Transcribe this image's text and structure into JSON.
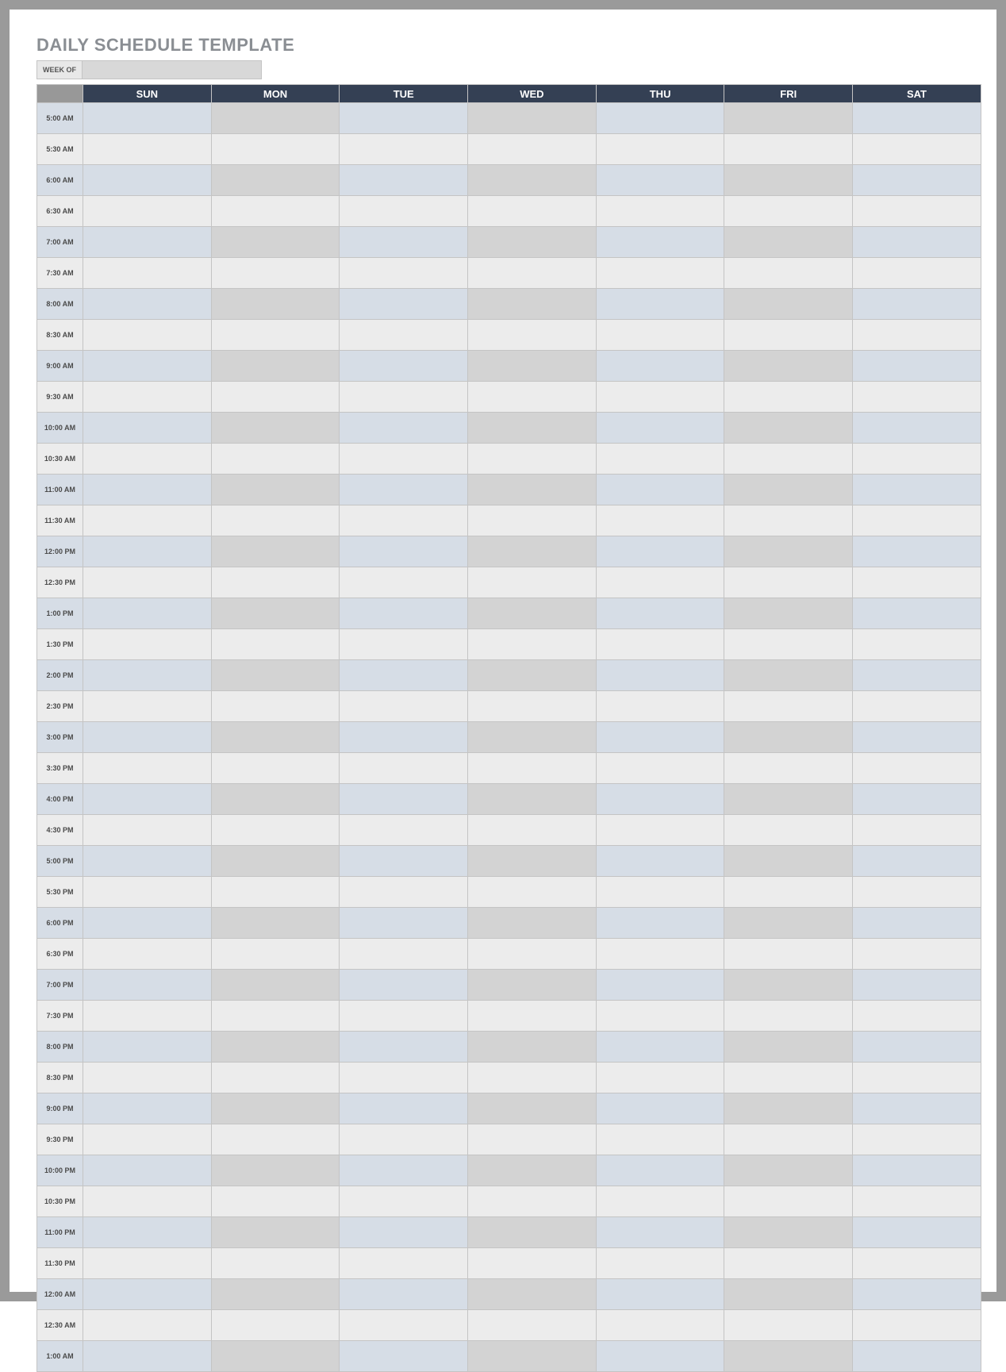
{
  "title": "DAILY SCHEDULE TEMPLATE",
  "week_of_label": "WEEK OF",
  "week_of_value": "",
  "days": [
    "SUN",
    "MON",
    "TUE",
    "WED",
    "THU",
    "FRI",
    "SAT"
  ],
  "times": [
    "5:00 AM",
    "5:30 AM",
    "6:00 AM",
    "6:30 AM",
    "7:00 AM",
    "7:30 AM",
    "8:00 AM",
    "8:30 AM",
    "9:00 AM",
    "9:30 AM",
    "10:00 AM",
    "10:30 AM",
    "11:00 AM",
    "11:30 AM",
    "12:00 PM",
    "12:30 PM",
    "1:00 PM",
    "1:30 PM",
    "2:00 PM",
    "2:30 PM",
    "3:00 PM",
    "3:30 PM",
    "4:00 PM",
    "4:30 PM",
    "5:00 PM",
    "5:30 PM",
    "6:00 PM",
    "6:30 PM",
    "7:00 PM",
    "7:30 PM",
    "8:00 PM",
    "8:30 PM",
    "9:00 PM",
    "9:30 PM",
    "10:00 PM",
    "10:30 PM",
    "11:00 PM",
    "11:30 PM",
    "12:00 AM",
    "12:30 AM",
    "1:00 AM"
  ],
  "colors": {
    "header_bg": "#344054",
    "header_time_bg": "#989898",
    "alt_blue": "#d6dde6",
    "alt_grey": "#d3d3d3",
    "plain_grey": "#ececec",
    "border": "#c4c4c4",
    "title_color": "#8a8e93"
  }
}
